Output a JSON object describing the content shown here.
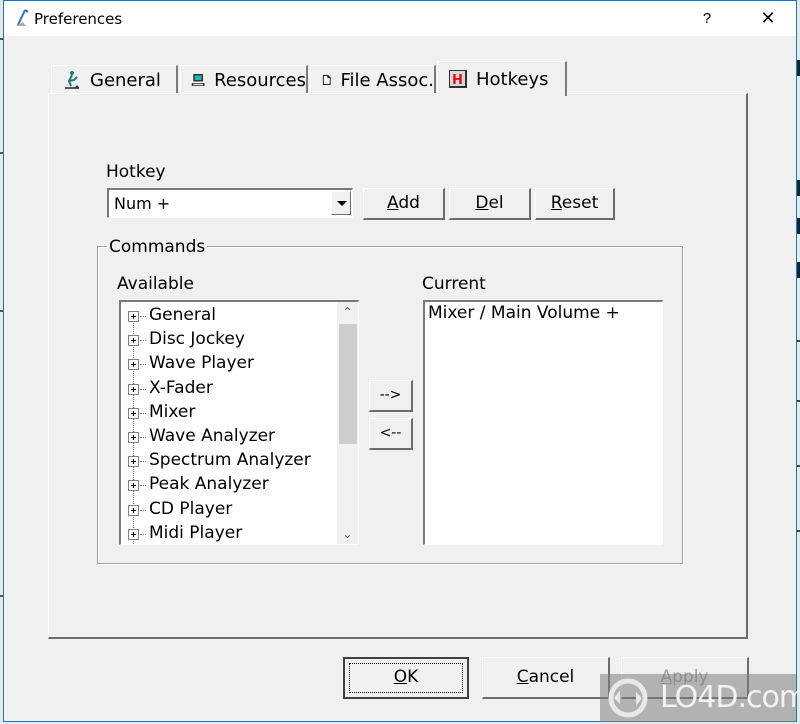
{
  "window": {
    "title": "Preferences",
    "help_label": "?",
    "close_label": "✕"
  },
  "tabs": [
    {
      "label": "General",
      "icon": "dj-figure-icon",
      "active": false
    },
    {
      "label": "Resources",
      "icon": "computer-icon",
      "active": false
    },
    {
      "label": "File Assoc.",
      "icon": "document-icon",
      "active": false
    },
    {
      "label": "Hotkeys",
      "icon": "hotkey-h-icon",
      "active": true
    }
  ],
  "hotkey": {
    "label": "Hotkey",
    "selected": "Num +",
    "buttons": {
      "add": {
        "prefix": "",
        "accel": "A",
        "suffix": "dd"
      },
      "del": {
        "prefix": "",
        "accel": "D",
        "suffix": "el"
      },
      "reset": {
        "prefix": "",
        "accel": "R",
        "suffix": "eset"
      }
    }
  },
  "commands": {
    "legend": "Commands",
    "available_label": "Available",
    "current_label": "Current",
    "available_items": [
      "General",
      "Disc Jockey",
      "Wave Player",
      "X-Fader",
      "Mixer",
      "Wave Analyzer",
      "Spectrum Analyzer",
      "Peak Analyzer",
      "CD Player",
      "Midi Player"
    ],
    "current_items": [
      "Mixer / Main Volume +"
    ],
    "move_right_label": "-->",
    "move_left_label": "<--",
    "scroll_up": "^",
    "scroll_down": "v"
  },
  "footer": {
    "ok": {
      "accel": "O",
      "suffix": "K"
    },
    "cancel": {
      "accel": "C",
      "suffix": "ancel"
    },
    "apply": {
      "accel": "A",
      "suffix": "pply",
      "disabled": true
    }
  },
  "watermark": {
    "text": "LO4D.com"
  }
}
